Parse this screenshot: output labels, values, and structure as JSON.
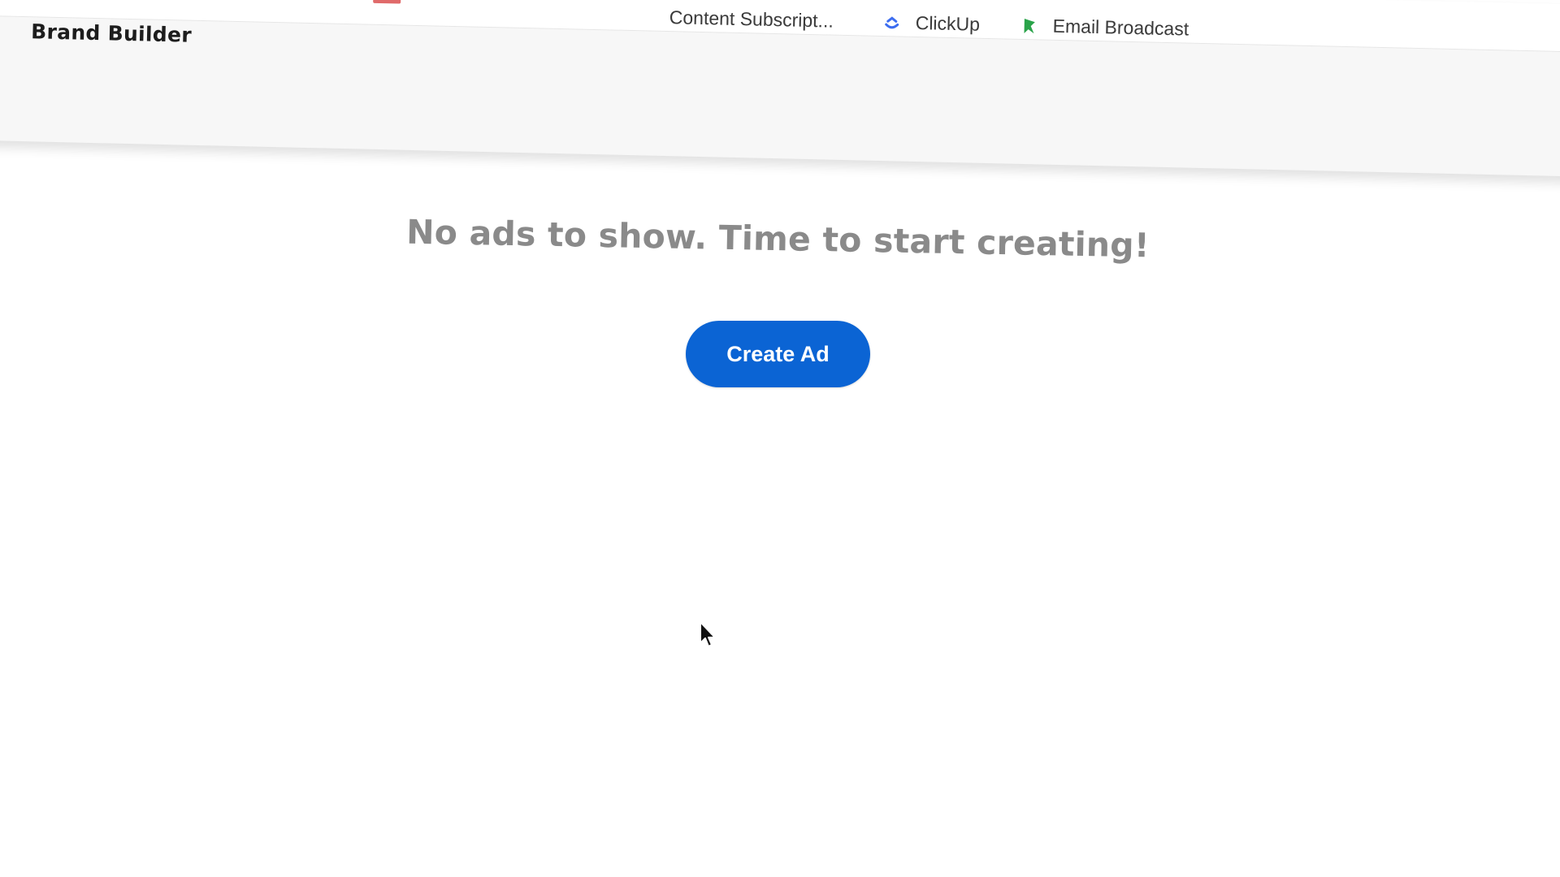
{
  "bookmarks": [
    {
      "label": "Content Subscript...",
      "icon": "none"
    },
    {
      "label": "ClickUp",
      "icon": "clickup-icon"
    },
    {
      "label": "Email Broadcast",
      "icon": "email-broadcast-icon"
    }
  ],
  "app": {
    "title": "Brand Builder"
  },
  "main": {
    "empty_message": "No ads to show. Time to start creating!",
    "create_button_label": "Create Ad"
  },
  "colors": {
    "accent": "#0b64d4",
    "message": "#8a8a8a",
    "clickup_icon": "#3c6df0",
    "email_icon": "#2aa34a"
  }
}
